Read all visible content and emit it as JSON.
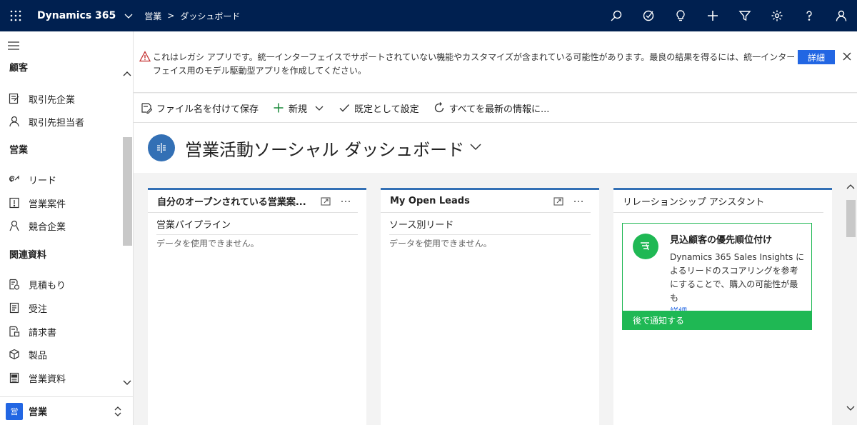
{
  "topbar": {
    "app_name": "Dynamics 365",
    "breadcrumb": [
      "営業",
      "ダッシュボード"
    ],
    "icons": [
      "search-icon",
      "task-icon",
      "lightbulb-icon",
      "plus-icon",
      "filter-icon",
      "gear-icon",
      "help-icon",
      "user-icon"
    ]
  },
  "sidebar": {
    "sections": [
      {
        "title": "顧客",
        "items": [
          {
            "label": "取引先企業",
            "icon": "account-icon"
          },
          {
            "label": "取引先担当者",
            "icon": "contact-icon"
          }
        ]
      },
      {
        "title": "営業",
        "items": [
          {
            "label": "リード",
            "icon": "lead-icon"
          },
          {
            "label": "営業案件",
            "icon": "opportunity-icon"
          },
          {
            "label": "競合企業",
            "icon": "competitor-icon"
          }
        ]
      },
      {
        "title": "関連資料",
        "items": [
          {
            "label": "見積もり",
            "icon": "quote-icon"
          },
          {
            "label": "受注",
            "icon": "order-icon"
          },
          {
            "label": "請求書",
            "icon": "invoice-icon"
          },
          {
            "label": "製品",
            "icon": "product-icon"
          },
          {
            "label": "営業資料",
            "icon": "sales-literature-icon"
          }
        ]
      }
    ],
    "area": {
      "badge": "営",
      "label": "営業"
    }
  },
  "notice": {
    "text": "これはレガシ アプリです。統一インターフェイスでサポートされていない機能やカスタマイズが含まれている可能性があります。最良の結果を得るには、統一インターフェイス用のモデル駆動型アプリを作成してください。",
    "button": "詳細"
  },
  "commands": {
    "save_as": "ファイル名を付けて保存",
    "new": "新規",
    "set_default": "既定として設定",
    "refresh_all": "すべてを最新の情報に..."
  },
  "dashboard": {
    "title": "営業活動ソーシャル ダッシュボード",
    "icon_color": "#3370b5"
  },
  "cards": [
    {
      "title": "自分のオープンされている営業案...",
      "subtitle": "営業パイプライン",
      "empty": "データを使用できません。"
    },
    {
      "title": "My Open Leads",
      "subtitle": "ソース別リード",
      "empty": "データを使用できません。"
    }
  ],
  "relationship_assistant": {
    "title": "リレーションシップ アシスタント",
    "heading": "見込顧客の優先順位付け",
    "body": "Dynamics 365 Sales Insights によるリードのスコアリングを参考にすることで、購入の可能性が最も",
    "more": "詳細",
    "footer": "後で通知する",
    "accent": "#1fb854"
  },
  "colors": {
    "topbar": "#002050",
    "accent": "#2266e3"
  }
}
